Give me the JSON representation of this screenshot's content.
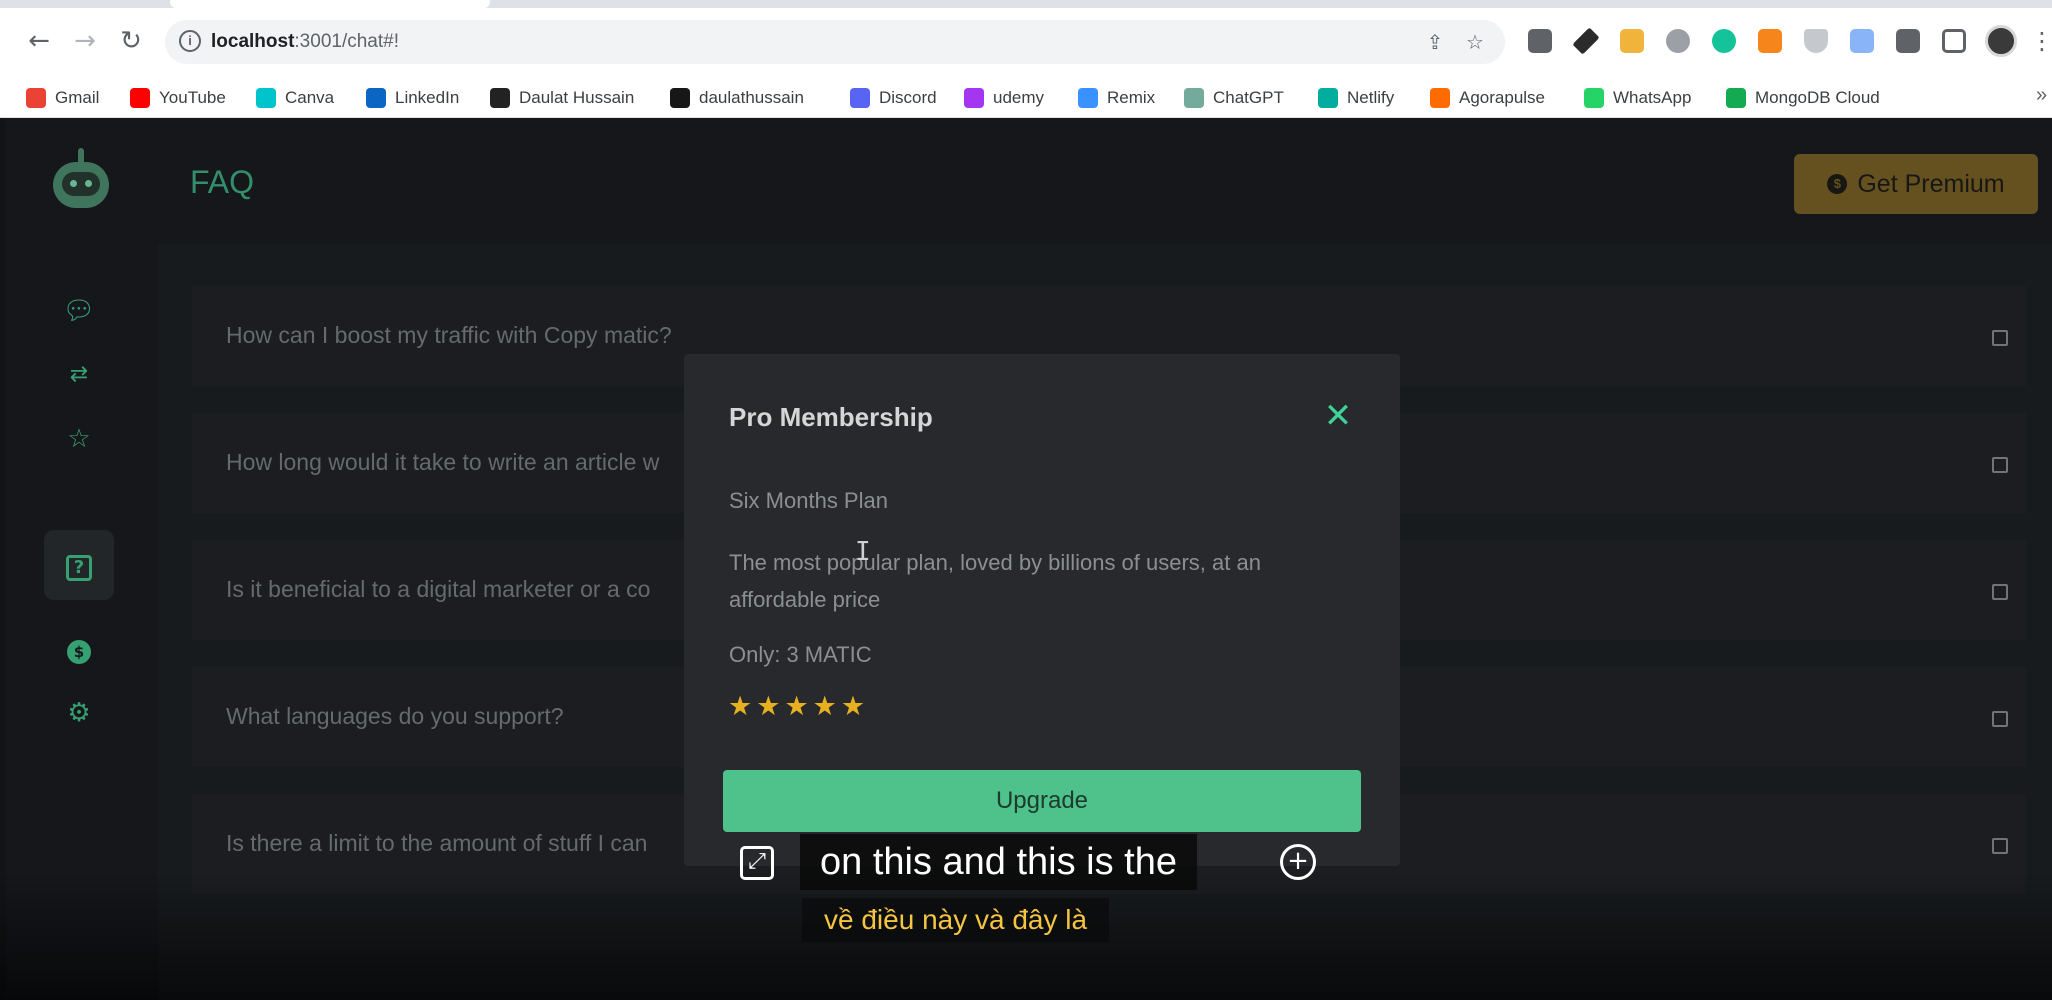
{
  "browser": {
    "url_host": "localhost",
    "url_path": ":3001/chat#!",
    "bookmarks": [
      {
        "label": "Gmail",
        "color": "#ea4335"
      },
      {
        "label": "YouTube",
        "color": "#ff0000"
      },
      {
        "label": "Canva",
        "color": "#00c4cc"
      },
      {
        "label": "LinkedIn",
        "color": "#0a66c2"
      },
      {
        "label": "Daulat Hussain",
        "color": "#222222"
      },
      {
        "label": "daulathussain",
        "color": "#181717"
      },
      {
        "label": "Discord",
        "color": "#5865f2"
      },
      {
        "label": "udemy",
        "color": "#a435f0"
      },
      {
        "label": "Remix",
        "color": "#3992ff"
      },
      {
        "label": "ChatGPT",
        "color": "#74aa9c"
      },
      {
        "label": "Netlify",
        "color": "#00ad9f"
      },
      {
        "label": "Agorapulse",
        "color": "#ff6b00"
      },
      {
        "label": "WhatsApp",
        "color": "#25d366"
      },
      {
        "label": "MongoDB Cloud",
        "color": "#13aa52"
      }
    ]
  },
  "header": {
    "title": "FAQ",
    "premium_label": "Get Premium"
  },
  "sidebar": {
    "items": [
      "chat-icon",
      "swap-icon",
      "star-icon",
      "help-icon",
      "dollar-icon",
      "settings-icon"
    ],
    "active": "help-icon"
  },
  "faq": {
    "items": [
      "How can I boost my traffic with Copy matic?",
      "How long would it take to write an article w",
      "Is it beneficial to a digital marketer or a co",
      "What languages do you support?",
      "Is there a limit to the amount of stuff I can"
    ]
  },
  "modal": {
    "title": "Pro Membership",
    "plan_name": "Six Months Plan",
    "description": "The most popular plan, loved by billions of users, at an affordable price",
    "price": "Only: 3 MATIC",
    "rating": 5,
    "upgrade_label": "Upgrade"
  },
  "caption": {
    "line": "on this and this is the",
    "translation": "về điều này và đây là"
  },
  "colors": {
    "accent": "#3fae83",
    "premium": "#7a6326",
    "upgrade": "#4fc18a",
    "star": "#e6b021"
  }
}
